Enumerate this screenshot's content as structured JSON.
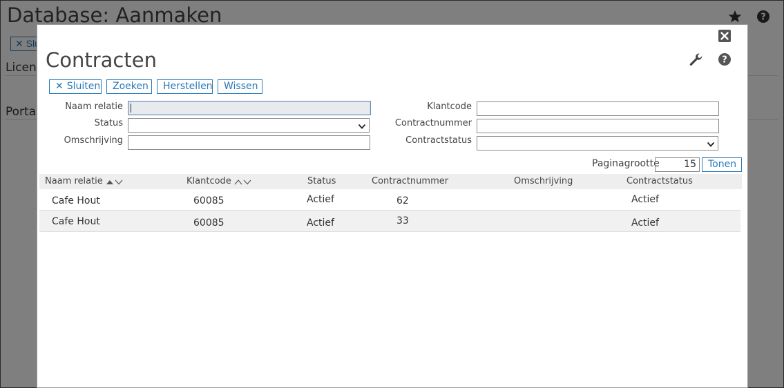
{
  "background": {
    "title": "Database: Aanmaken",
    "close_button_label": "Slu",
    "section1": "Licenti",
    "section2": "Portaa"
  },
  "modal": {
    "title": "Contracten",
    "toolbar": {
      "close_label": "Sluiten",
      "search_label": "Zoeken",
      "reset_label": "Herstellen",
      "clear_label": "Wissen"
    },
    "filters": {
      "naam_relatie_label": "Naam relatie",
      "naam_relatie_value": "",
      "status_label": "Status",
      "status_value": "",
      "omschrijving_label": "Omschrijving",
      "omschrijving_value": "",
      "klantcode_label": "Klantcode",
      "klantcode_value": "",
      "contractnummer_label": "Contractnummer",
      "contractnummer_value": "",
      "contractstatus_label": "Contractstatus",
      "contractstatus_value": ""
    },
    "paging": {
      "label": "Paginagrootte",
      "value": "15",
      "show_label": "Tonen"
    },
    "table": {
      "columns": [
        "Naam relatie",
        "Klantcode",
        "Status",
        "Contractnummer",
        "Omschrijving",
        "Contractstatus"
      ],
      "rows": [
        [
          "Cafe Hout",
          "60085",
          "Actief",
          "62",
          "",
          "Actief"
        ],
        [
          "Cafe Hout",
          "60085",
          "Actief",
          "33",
          "",
          "Actief"
        ]
      ]
    }
  },
  "colors": {
    "accent": "#2a7ab8",
    "overlay": "#7b7b7b",
    "header_bg": "#eeeeee",
    "alt_row_bg": "#f1f1f1"
  },
  "icons": [
    "star-icon",
    "help-icon",
    "close-icon",
    "wrench-icon",
    "sort-asc-icon",
    "sort-desc-icon",
    "chevron-down-icon"
  ]
}
